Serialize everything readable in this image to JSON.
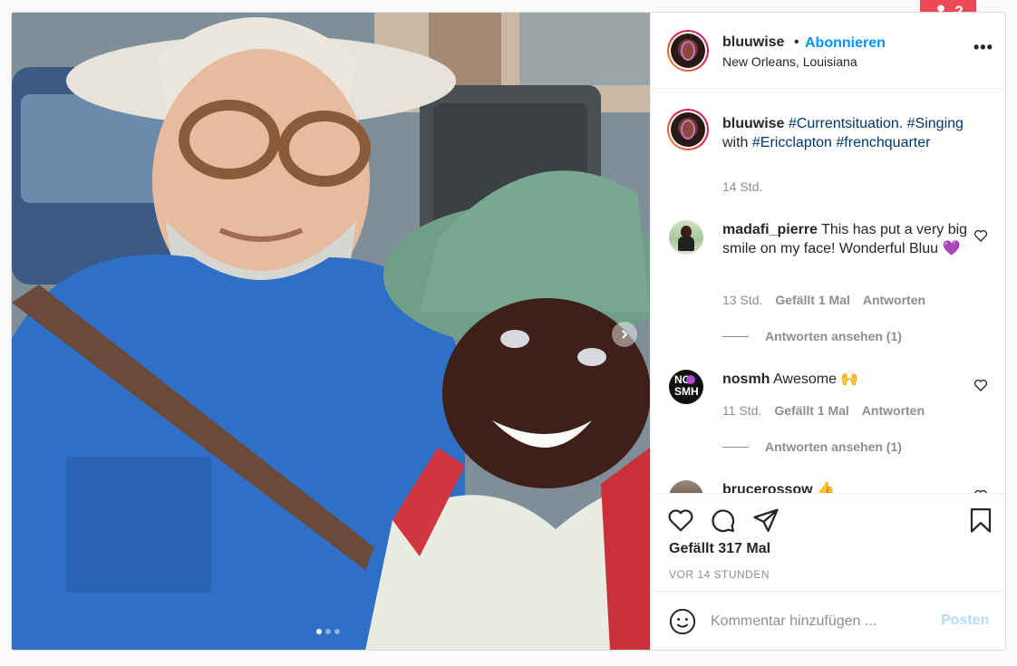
{
  "notification": {
    "count": "2",
    "icon": "person-icon",
    "color": "#ed4956"
  },
  "header": {
    "username": "bluuwise",
    "separator": "•",
    "follow_label": "Abonnieren",
    "location": "New Orleans, Louisiana",
    "more_icon": "•••"
  },
  "caption": {
    "username": "bluuwise",
    "text_tag1": "#Currentsituation",
    "text_mid": ". ",
    "text_tag2": "#Singing",
    "text_with": "with ",
    "text_tag3": "#Ericclapton",
    "text_space": " ",
    "text_tag4": "#frenchquarter",
    "time": "14 Std."
  },
  "comments": [
    {
      "username": "madafi_pierre",
      "text": "This has put a very big smile on my face! Wonderful Bluu 💜",
      "time": "13 Std.",
      "likes": "Gefällt 1 Mal",
      "reply": "Antworten",
      "view_replies": "Antworten ansehen (1)"
    },
    {
      "username": "nosmh",
      "text": "Awesome 🙌",
      "time": "11 Std.",
      "likes": "Gefällt 1 Mal",
      "reply": "Antworten",
      "view_replies": "Antworten ansehen (1)",
      "avatar_text": "NO SMH"
    },
    {
      "username": "brucerossow",
      "text": "👍"
    }
  ],
  "actions": {
    "likes": "Gefällt 317 Mal",
    "time_ago": "VOR 14 STUNDEN"
  },
  "compose": {
    "placeholder": "Kommentar hinzufügen ...",
    "post_label": "Posten"
  },
  "carousel": {
    "slides": 3,
    "current": 1
  },
  "colors": {
    "accent": "#0095f6",
    "hashtag": "#00376b",
    "muted": "#8e8e8e",
    "post_disabled": "#b3dbff"
  }
}
